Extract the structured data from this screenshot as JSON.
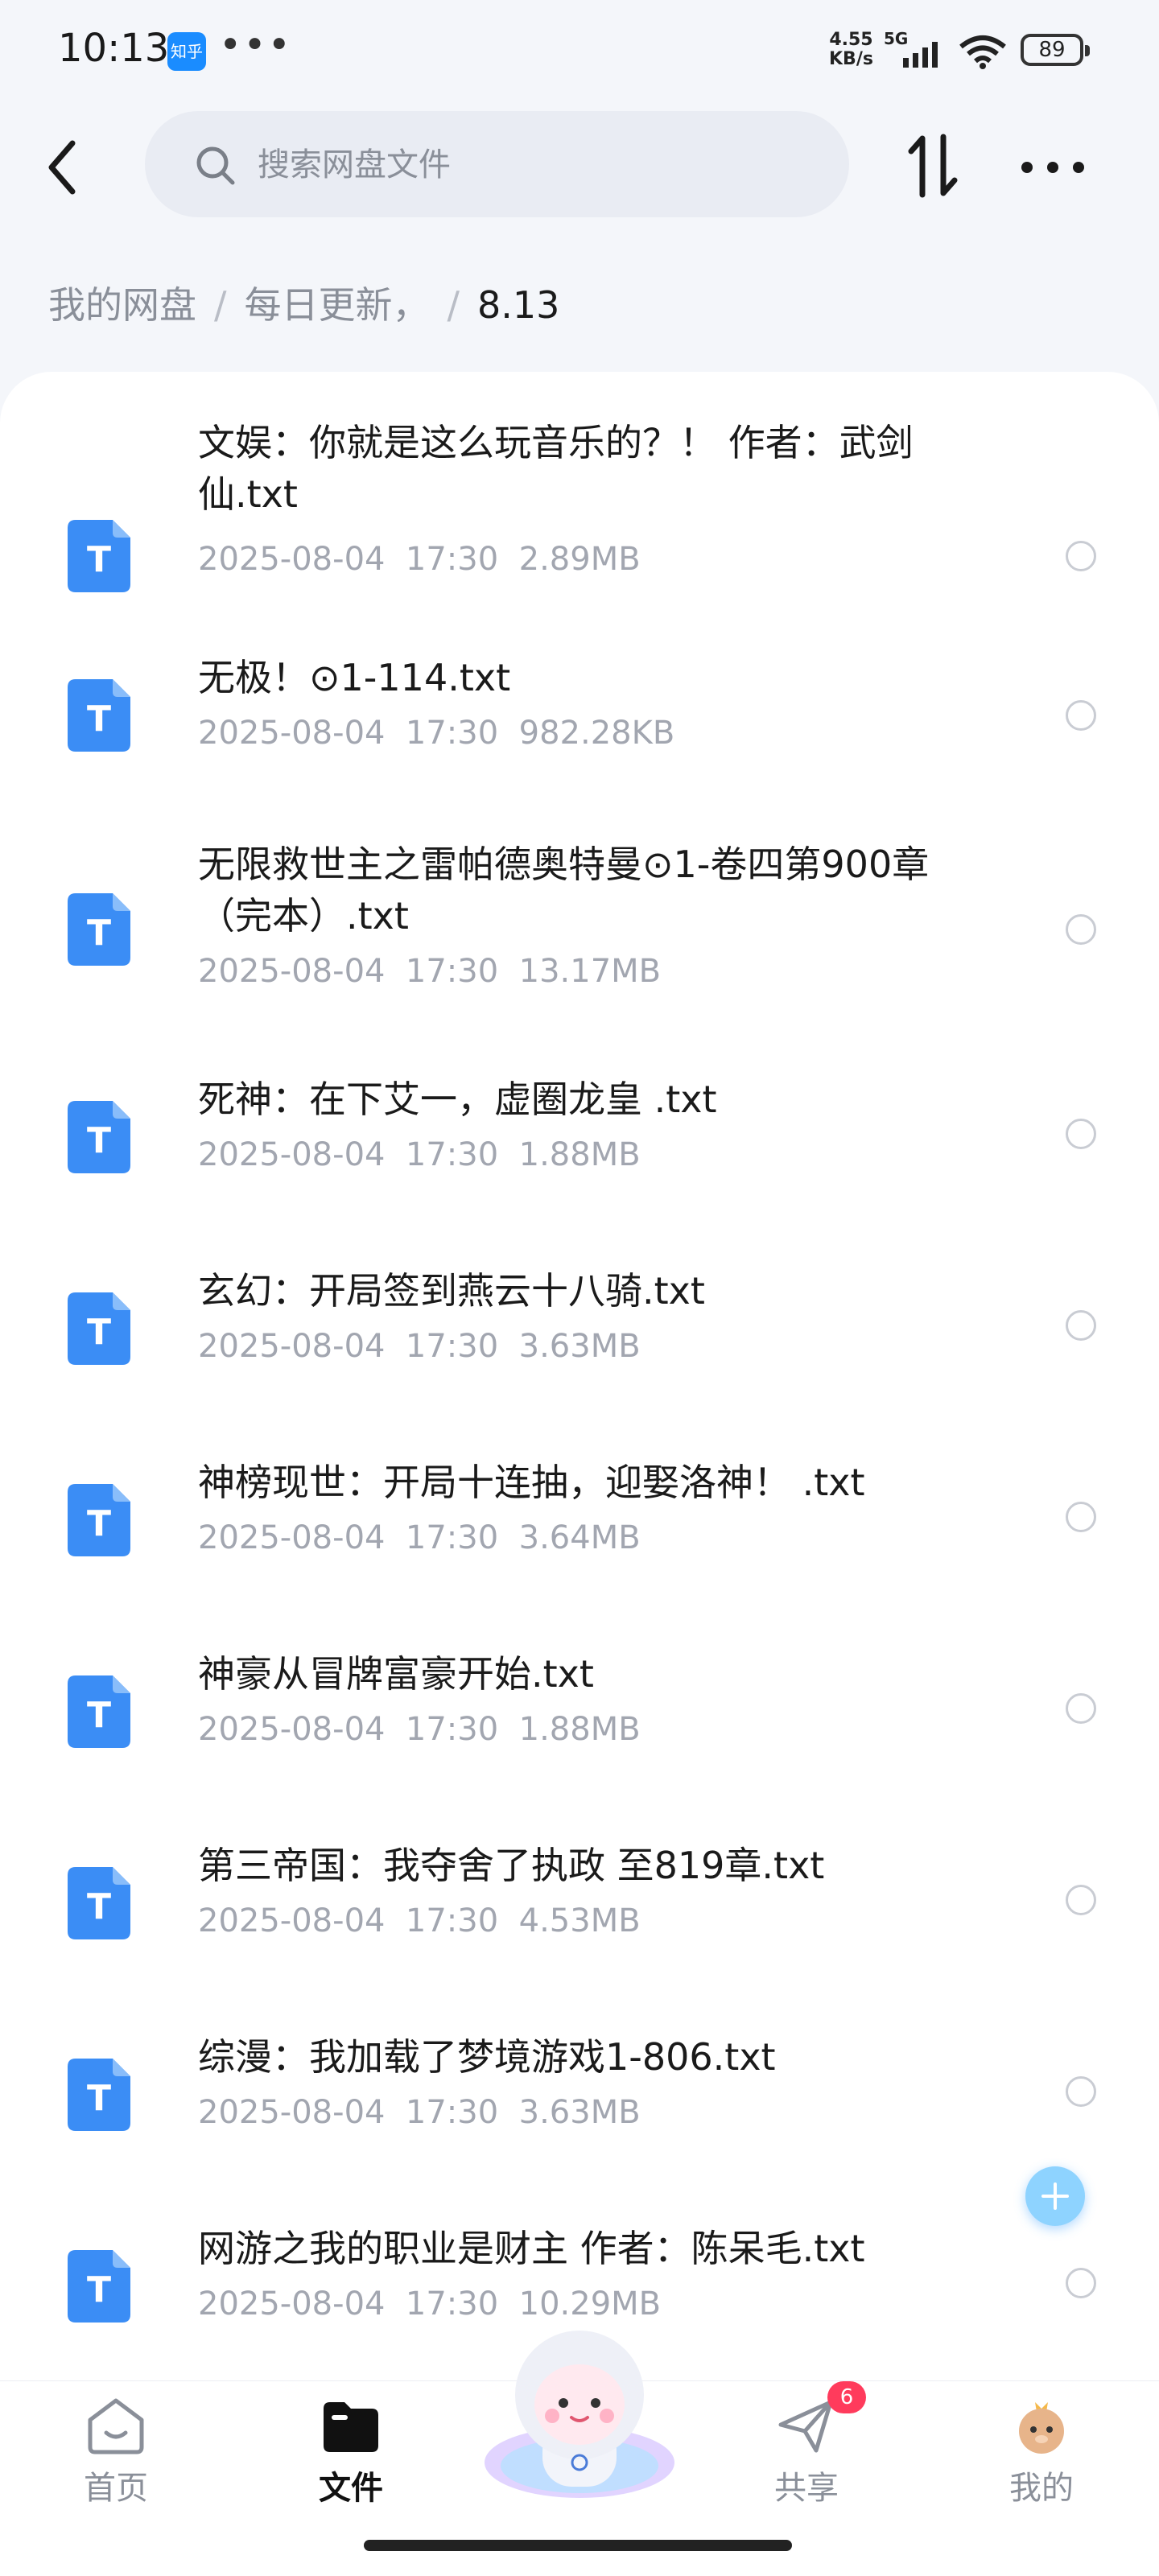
{
  "status_bar": {
    "time": "10:13",
    "app_badge": "知乎",
    "net_speed_value": "4.55",
    "net_speed_unit": "KB/s",
    "network": "5G",
    "battery": "89"
  },
  "top_nav": {
    "search_placeholder": "搜索网盘文件",
    "icons": [
      "back-arrow-icon",
      "search-icon",
      "sort-icon",
      "more-icon"
    ]
  },
  "breadcrumb": {
    "items": [
      "我的网盘",
      "每日更新，",
      "8.13"
    ],
    "separator": "/"
  },
  "files": [
    {
      "name": "文娱：你就是这么玩音乐的？！ 作者：武剑仙.txt",
      "date": "2025-08-04",
      "time": "17:30",
      "size": "2.89MB"
    },
    {
      "name": "无极！⊙1-114.txt",
      "date": "2025-08-04",
      "time": "17:30",
      "size": "982.28KB"
    },
    {
      "name": "无限救世主之雷帕德奥特曼⊙1-卷四第900章（完本）.txt",
      "date": "2025-08-04",
      "time": "17:30",
      "size": "13.17MB"
    },
    {
      "name": "死神：在下艾一，虚圈龙皇 .txt",
      "date": "2025-08-04",
      "time": "17:30",
      "size": "1.88MB"
    },
    {
      "name": "玄幻：开局签到燕云十八骑.txt",
      "date": "2025-08-04",
      "time": "17:30",
      "size": "3.63MB"
    },
    {
      "name": "神榜现世：开局十连抽，迎娶洛神！ .txt",
      "date": "2025-08-04",
      "time": "17:30",
      "size": "3.64MB"
    },
    {
      "name": "神豪从冒牌富豪开始.txt",
      "date": "2025-08-04",
      "time": "17:30",
      "size": "1.88MB"
    },
    {
      "name": "第三帝国：我夺舍了执政 至819章.txt",
      "date": "2025-08-04",
      "time": "17:30",
      "size": "4.53MB"
    },
    {
      "name": "综漫：我加载了梦境游戏1-806.txt",
      "date": "2025-08-04",
      "time": "17:30",
      "size": "3.63MB"
    },
    {
      "name": "网游之我的职业是财主 作者：陈呆毛.txt",
      "date": "2025-08-04",
      "time": "17:30",
      "size": "10.29MB"
    }
  ],
  "file_icon_letter": "T",
  "bottom_nav": {
    "tabs": [
      {
        "label": "首页",
        "icon": "home-icon",
        "active": false
      },
      {
        "label": "文件",
        "icon": "folder-icon",
        "active": true
      },
      {
        "label": "共享",
        "icon": "share-send-icon",
        "active": false,
        "badge": "6"
      },
      {
        "label": "我的",
        "icon": "profile-avatar-icon",
        "active": false
      }
    ]
  },
  "colors": {
    "accent": "#3b8df5",
    "file_icon": "#3b8df5",
    "badge": "#ff3b5c",
    "muted_text": "#a2a6b0"
  }
}
